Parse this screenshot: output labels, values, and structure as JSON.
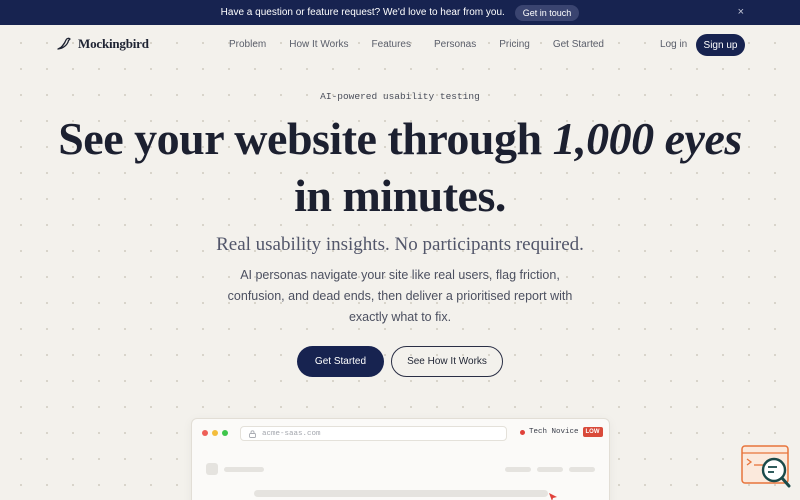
{
  "announcement": {
    "text": "Have a question or feature request? We'd love to hear from you.",
    "cta": "Get in touch",
    "close": "×"
  },
  "nav": {
    "brand": "Mockingbird",
    "links": [
      "Problem",
      "How It Works",
      "Features",
      "Personas",
      "Pricing",
      "Get Started"
    ],
    "login": "Log in",
    "signup": "Sign up"
  },
  "hero": {
    "eyebrow": "AI-powered usability testing",
    "headline_part1": "See your website through ",
    "headline_emphasis": "1,000 eyes",
    "headline_part2": "in minutes.",
    "subheadline": "Real usability insights. No participants required.",
    "description": "AI personas navigate your site like real users, flag friction, confusion, and dead ends, then deliver a prioritised report with exactly what to fix.",
    "primary_cta": "Get Started",
    "secondary_cta": "See How It Works"
  },
  "mockup": {
    "url": "acme-saas.com",
    "persona_name": "Tech Novice",
    "persona_level": "LOW",
    "traffic_light_colors": [
      "#ee5f57",
      "#f3bd3c",
      "#3ec54b"
    ]
  },
  "colors": {
    "brand_navy": "#172350",
    "background": "#f3f1ec",
    "accent_orange": "#e8743b",
    "danger_red": "#d94a3a"
  },
  "icons": {
    "logo": "bird-icon",
    "close": "close-icon",
    "lock": "lock-icon",
    "cursor": "cursor-icon",
    "widget": "chat-search-icon"
  }
}
